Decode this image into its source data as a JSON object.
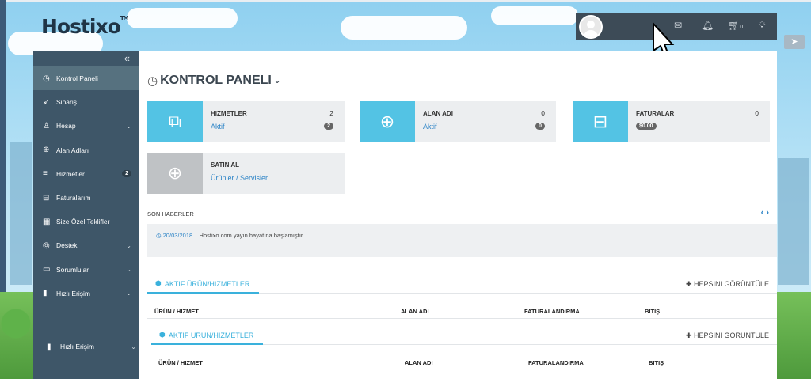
{
  "brand": {
    "logo": "Hostixo",
    "tm": "TM"
  },
  "topbar": {
    "cart_count": "0"
  },
  "sidebar": {
    "collapse_icon": "«",
    "items": [
      {
        "label": "Kontrol Paneli",
        "icon": "dashboard-icon"
      },
      {
        "label": "Sipariş",
        "icon": "rocket-icon"
      },
      {
        "label": "Hesap",
        "icon": "user-icon"
      },
      {
        "label": "Alan Adları",
        "icon": "globe-icon"
      },
      {
        "label": "Hizmetler",
        "icon": "server-icon",
        "badge": "2"
      },
      {
        "label": "Faturalarım",
        "icon": "inbox-icon"
      },
      {
        "label": "Size Özel Teklifler",
        "icon": "calculator-icon"
      },
      {
        "label": "Destek",
        "icon": "lifebuoy-icon"
      },
      {
        "label": "Sorumlular",
        "icon": "folder-icon"
      },
      {
        "label": "Hızlı Erişim",
        "icon": "bookmark-icon"
      }
    ],
    "bottom_item": {
      "label": "Hızlı Erişim"
    }
  },
  "page": {
    "title": "KONTROL PANELI"
  },
  "cards": [
    {
      "title": "HIZMETLER",
      "count": "2",
      "link": "Aktif",
      "badge": "2"
    },
    {
      "title": "ALAN ADI",
      "count": "0",
      "link": "Aktif",
      "badge": "0"
    },
    {
      "title": "FATURALAR",
      "count": "0",
      "amount": "$0.00"
    },
    {
      "title": "SATIN AL",
      "link": "Ürünler / Servisler"
    }
  ],
  "news": {
    "heading": "SON HABERLER",
    "date": "20/03/2018",
    "text": "Hostixo.com yayın hayatına başlamıştır."
  },
  "products": {
    "tab": "AKTIF ÜRÜN/HIZMETLER",
    "view_all": "HEPSINI GÖRÜNTÜLE",
    "columns": [
      "ÜRÜN / HIZMET",
      "ALAN ADI",
      "FATURALANDIRMA",
      "BITIŞ"
    ]
  },
  "colors": {
    "accent": "#53c3e4",
    "sidebar": "#3e5668",
    "link": "#2b83c6"
  }
}
